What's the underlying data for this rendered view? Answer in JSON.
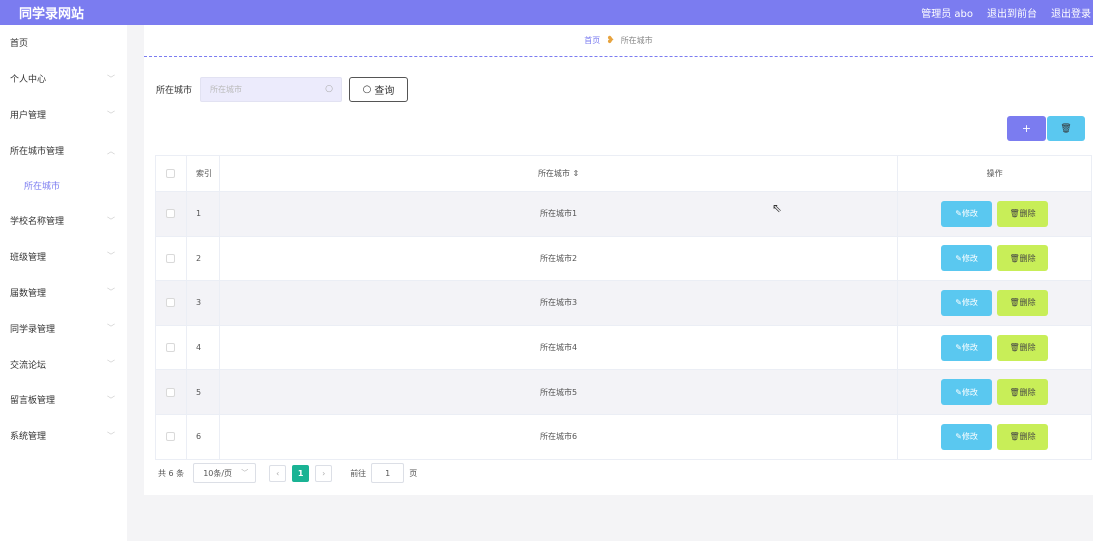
{
  "header": {
    "title": "同学录网站",
    "user": "管理员 abo",
    "exit_front": "退出到前台",
    "logout": "退出登录"
  },
  "sidebar": {
    "items": [
      {
        "label": "首页",
        "chevron": ""
      },
      {
        "label": "个人中心",
        "chevron": "﹀"
      },
      {
        "label": "用户管理",
        "chevron": "﹀"
      },
      {
        "label": "所在城市管理",
        "chevron": "︿"
      },
      {
        "label": "学校名称管理",
        "chevron": "﹀"
      },
      {
        "label": "班级管理",
        "chevron": "﹀"
      },
      {
        "label": "届数管理",
        "chevron": "﹀"
      },
      {
        "label": "同学录管理",
        "chevron": "﹀"
      },
      {
        "label": "交流论坛",
        "chevron": "﹀"
      },
      {
        "label": "留言板管理",
        "chevron": "﹀"
      },
      {
        "label": "系统管理",
        "chevron": "﹀"
      }
    ],
    "active_sub": "所在城市"
  },
  "breadcrumb": {
    "home": "首页",
    "current": "所在城市"
  },
  "search": {
    "label": "所在城市",
    "placeholder": "所在城市",
    "button": "查询"
  },
  "actions": {
    "add": "+",
    "delete": "🗑"
  },
  "table": {
    "headers": [
      "索引",
      "所在城市 ⇕",
      "操作"
    ],
    "rows": [
      {
        "index": "1",
        "city": "所在城市1"
      },
      {
        "index": "2",
        "city": "所在城市2"
      },
      {
        "index": "3",
        "city": "所在城市3"
      },
      {
        "index": "4",
        "city": "所在城市4"
      },
      {
        "index": "5",
        "city": "所在城市5"
      },
      {
        "index": "6",
        "city": "所在城市6"
      }
    ],
    "edit_label": "修改",
    "delete_label": "删除"
  },
  "pagination": {
    "total": "共 6 条",
    "page_size": "10条/页",
    "current_page": "1",
    "goto_label": "前往",
    "goto_value": "1",
    "goto_unit": "页"
  },
  "colors": {
    "primary": "#7b7cf0",
    "info": "#5ac8f0",
    "lime": "#c8ee58",
    "pager_active": "#1ab394"
  }
}
